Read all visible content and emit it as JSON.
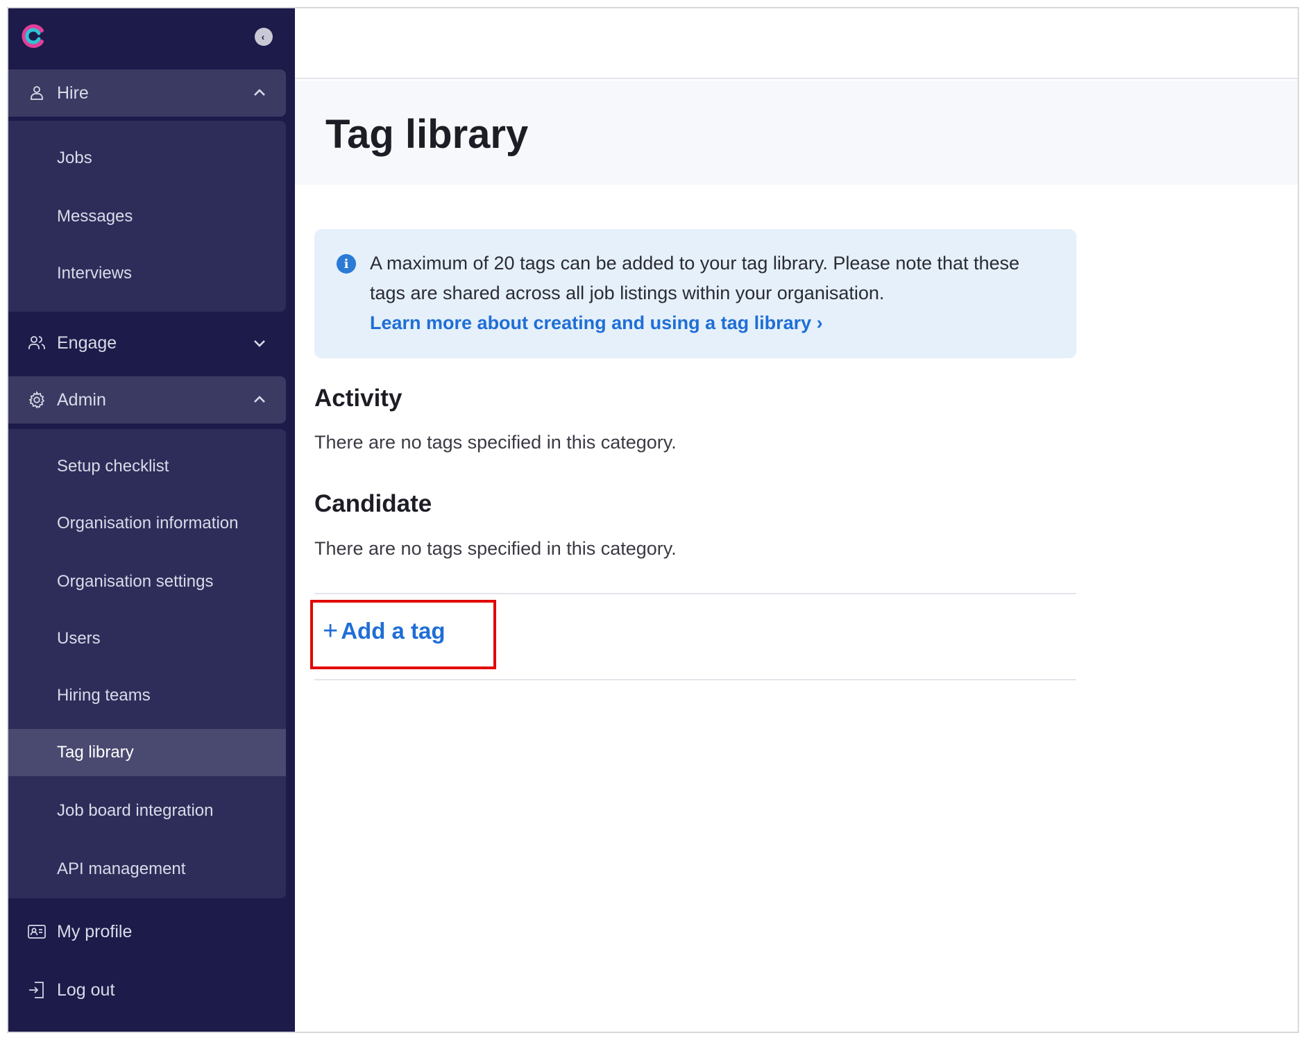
{
  "sidebar": {
    "sections": {
      "hire": {
        "label": "Hire",
        "items": [
          "Jobs",
          "Messages",
          "Interviews"
        ]
      },
      "engage": {
        "label": "Engage"
      },
      "admin": {
        "label": "Admin",
        "items": [
          "Setup checklist",
          "Organisation information",
          "Organisation settings",
          "Users",
          "Hiring teams",
          "Tag library",
          "Job board integration",
          "API management"
        ]
      }
    },
    "footer": {
      "my_profile": "My profile",
      "log_out": "Log out"
    },
    "selected_item": "Tag library"
  },
  "main": {
    "title": "Tag library",
    "info": {
      "text": "A maximum of 20 tags can be added to your tag library. Please note that these tags are shared across all job listings within your organisation.",
      "link": "Learn more about creating and using a tag library ›"
    },
    "categories": [
      {
        "name": "Activity",
        "empty_text": "There are no tags specified in this category."
      },
      {
        "name": "Candidate",
        "empty_text": "There are no tags specified in this category."
      }
    ],
    "add_tag": {
      "plus": "+",
      "label": "Add a tag"
    }
  },
  "colors": {
    "sidebar_bg": "#1c1b4a",
    "sidebar_sub_bg": "#2e2d5a",
    "link_blue": "#1f6ed6",
    "highlight_red": "#e10600",
    "info_bg": "#e5f0fa"
  }
}
